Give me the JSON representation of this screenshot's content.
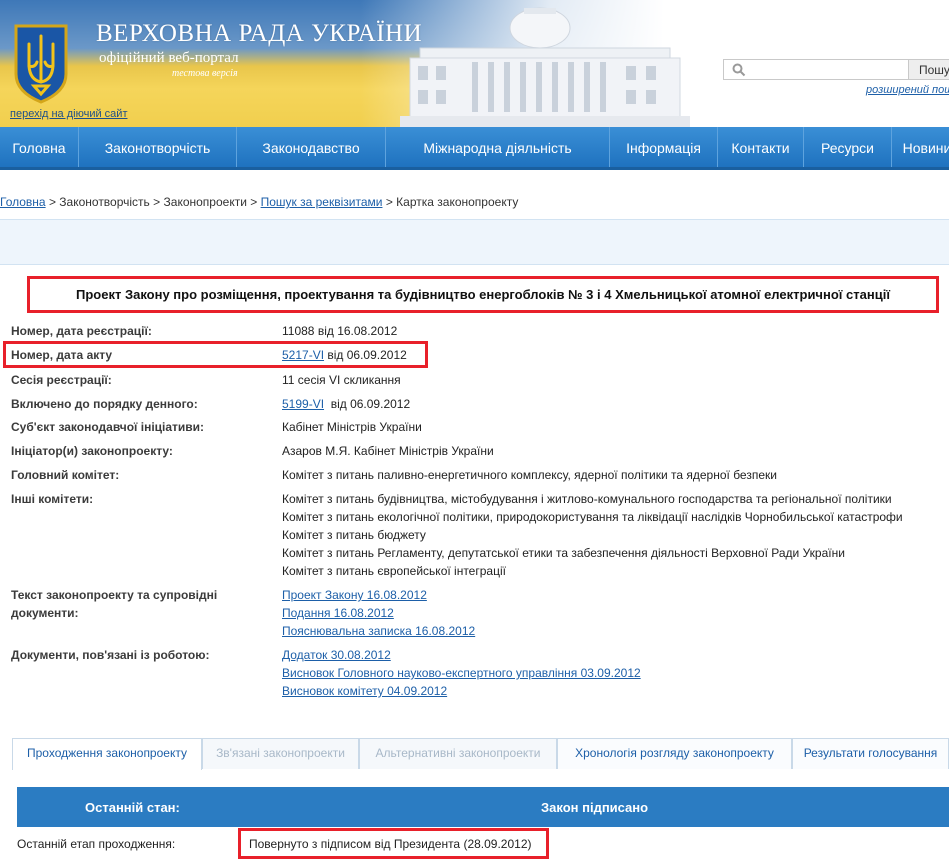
{
  "header": {
    "title": "ВЕРХОВНА РАДА УКРАЇНИ",
    "subtitle": "офіційний веб-портал",
    "test_version": "тестова версія",
    "goto_site": "перехід на діючий сайт",
    "search": {
      "placeholder": "",
      "button_label": "Пошук",
      "advanced_label": "розширений пошук"
    }
  },
  "nav": {
    "items": [
      "Головна",
      "Законотворчість",
      "Законодавство",
      "Міжнародна діяльність",
      "Інформація",
      "Контакти",
      "Ресурси",
      "Новини"
    ]
  },
  "breadcrumb": {
    "home": "Головна",
    "sep": ">",
    "lawmaking": "Законотворчість",
    "bills": "Законопроекти",
    "search": "Пошук за реквізитами",
    "current": "Картка законопроекту"
  },
  "bill": {
    "title": "Проект Закону про розміщення, проектування та будівництво енергоблоків № 3 і 4 Хмельницької атомної електричної станції",
    "fields": {
      "reg_number_label": "Номер, дата реєстрації:",
      "reg_number_value": "11088 від 16.08.2012",
      "act_label": "Номер, дата акту",
      "act_link": "5217-VI",
      "act_date": " від 06.09.2012",
      "session_label": "Сесія реєстрації:",
      "session_value": "11 сесія VI скликання",
      "agenda_label": "Включено до порядку денного:",
      "agenda_link": "5199-VI",
      "agenda_date": "від 06.09.2012",
      "subject_label": "Суб'єкт законодавчої ініціативи:",
      "subject_value": "Кабінет Міністрів України",
      "initiator_label": "Ініціатор(и) законопроекту:",
      "initiator_value": "Азаров М.Я. Кабінет Міністрів України",
      "main_committee_label": "Головний комітет:",
      "main_committee_value": "Комітет з питань паливно-енергетичного комплексу, ядерної політики та ядерної безпеки",
      "other_committees_label": "Інші комітети:",
      "other_committees": [
        "Комітет з питань будівництва, містобудування і житлово-комунального господарства та регіональної політики",
        "Комітет з питань екологічної політики, природокористування та ліквідації наслідків Чорнобильської катастрофи",
        "Комітет з питань бюджету",
        "Комітет з питань Регламенту, депутатської етики та забезпечення діяльності Верховної Ради України",
        "Комітет з питань європейської інтеграції"
      ],
      "texts_label_1": "Текст законопроекту та супровідні",
      "texts_label_2": "документи:",
      "texts": [
        "Проект Закону 16.08.2012",
        "Подання 16.08.2012",
        "Пояснювальна записка 16.08.2012"
      ],
      "docs_label": "Документи, пов'язані із роботою:",
      "docs": [
        "Додаток 30.08.2012",
        "Висновок Головного науково-експертного управління 03.09.2012",
        "Висновок комітету 04.09.2012"
      ]
    }
  },
  "tabs": [
    "Проходження законопроекту",
    "Зв'язані законопроекти",
    "Альтернативні законопроекти",
    "Хронологія розгляду законопроекту",
    "Результати голосування"
  ],
  "status": {
    "last_state_label": "Останній стан:",
    "last_state_value": "Закон підписано",
    "last_stage_label": "Останній етап проходження:",
    "last_stage_value": "Повернуто з підписом від Президента (28.09.2012)"
  },
  "colors": {
    "nav": "#1f72bf",
    "highlight": "#e8202a",
    "status_bar": "#2b7cc2",
    "link": "#1d5fa8"
  },
  "icons": {
    "crest": "trident-crest-icon",
    "search": "search-icon"
  }
}
